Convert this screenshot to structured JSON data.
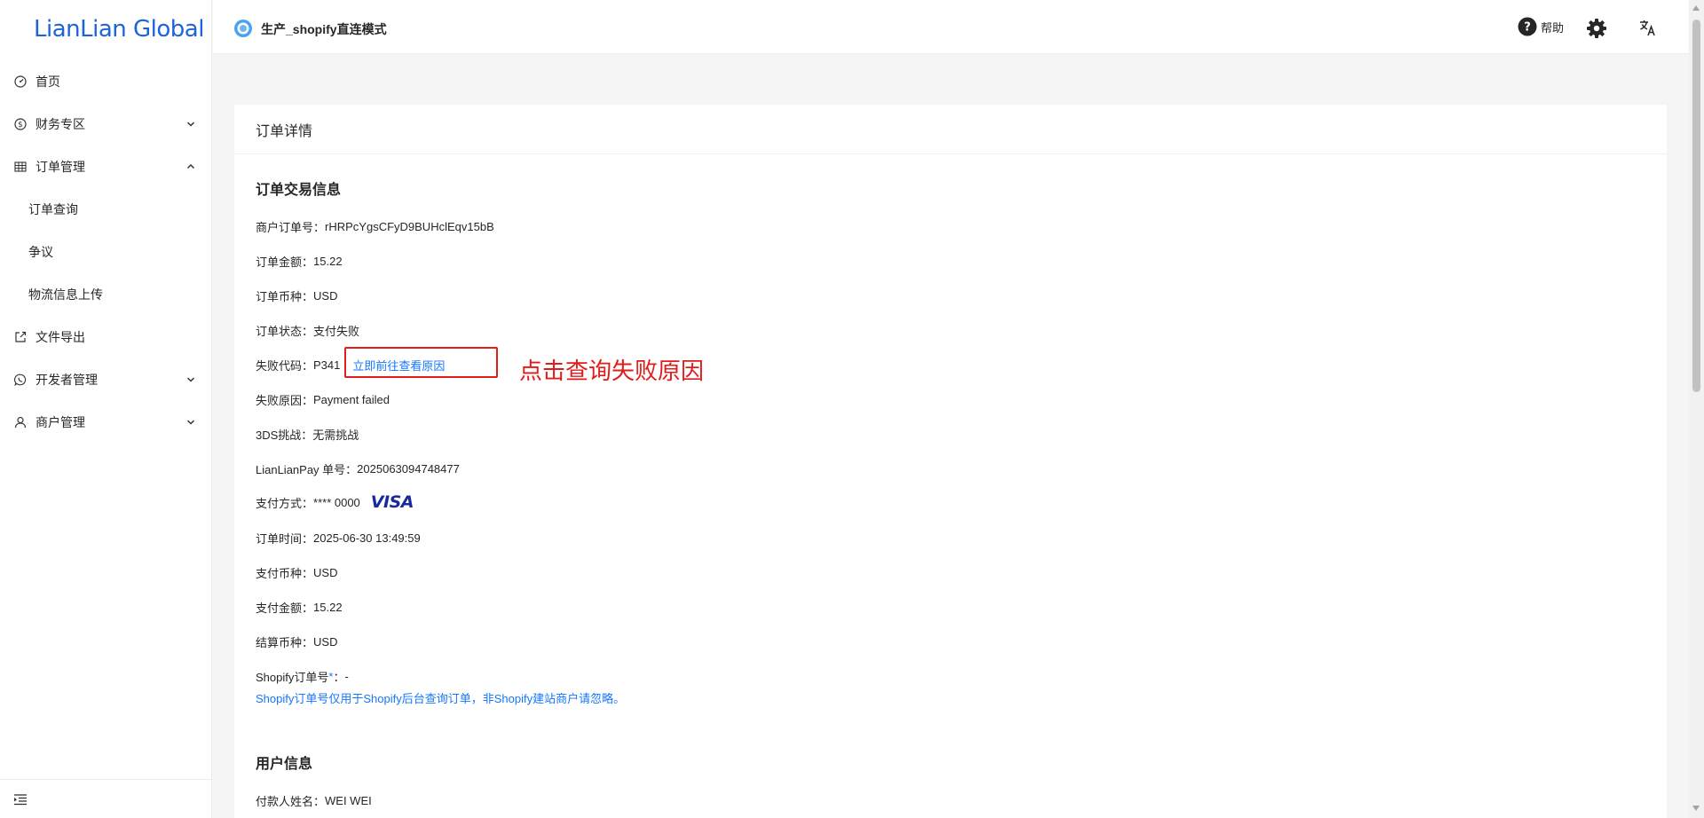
{
  "brand": {
    "logo_text": "LianLian Global",
    "accent": "#1e63d8"
  },
  "sidebar": {
    "items": [
      {
        "label": "首页",
        "icon": "dashboard-icon"
      },
      {
        "label": "财务专区",
        "icon": "dollar-circle-icon",
        "expandable": true,
        "expanded": false
      },
      {
        "label": "订单管理",
        "icon": "table-icon",
        "expandable": true,
        "expanded": true
      },
      {
        "label": "文件导出",
        "icon": "export-icon"
      },
      {
        "label": "开发者管理",
        "icon": "whatsapp-icon",
        "expandable": true,
        "expanded": false
      },
      {
        "label": "商户管理",
        "icon": "user-icon",
        "expandable": true,
        "expanded": false
      }
    ],
    "order_sub_items": [
      {
        "label": "订单查询"
      },
      {
        "label": "争议"
      },
      {
        "label": "物流信息上传"
      }
    ]
  },
  "topbar": {
    "store_name": "生产_shopify直连模式",
    "help_label": "帮助"
  },
  "card": {
    "title": "订单详情",
    "transaction_section_title": "订单交易信息",
    "fields": {
      "merchant_order_no": {
        "label": "商户订单号：",
        "value": "rHRPcYgsCFyD9BUHclEqv15bB"
      },
      "order_amount": {
        "label": "订单金额：",
        "value": "15.22"
      },
      "order_currency": {
        "label": "订单币种：",
        "value": "USD"
      },
      "order_status": {
        "label": "订单状态：",
        "value": "支付失败"
      },
      "fail_code": {
        "label": "失败代码：",
        "value": "P341",
        "link": "立即前往查看原因"
      },
      "fail_reason": {
        "label": "失败原因：",
        "value": "Payment failed"
      },
      "three_ds": {
        "label": "3DS挑战：",
        "value": "无需挑战"
      },
      "lianlianpay_no": {
        "label": "LianLianPay 单号：",
        "value": "2025063094748477"
      },
      "payment_method": {
        "label": "支付方式：",
        "value": "**** 0000",
        "card_brand": "VISA"
      },
      "order_time": {
        "label": "订单时间：",
        "value": "2025-06-30 13:49:59"
      },
      "pay_currency": {
        "label": "支付币种：",
        "value": "USD"
      },
      "pay_amount": {
        "label": "支付金额：",
        "value": "15.22"
      },
      "settle_currency": {
        "label": "结算币种：",
        "value": "USD"
      },
      "shopify_order_no": {
        "label": "Shopify订单号",
        "required_mark": "*",
        "colon": "：",
        "value": "-"
      }
    },
    "shopify_hint": "Shopify订单号仅用于Shopify后台查询订单，非Shopify建站商户请忽略。",
    "user_section_title": "用户信息",
    "payer_name": {
      "label": "付款人姓名：",
      "value": "WEI WEI"
    }
  },
  "annotation": {
    "text": "点击查询失败原因",
    "color": "#e21b1b"
  }
}
